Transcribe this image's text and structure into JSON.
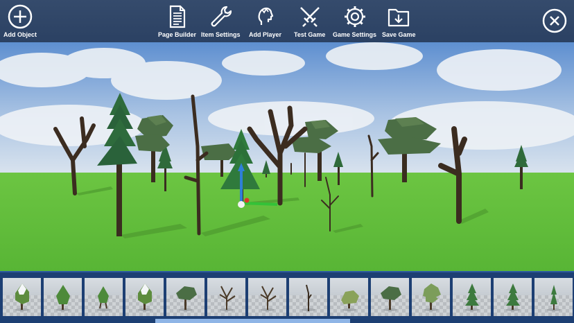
{
  "toolbar": {
    "add_object": "Add Object",
    "page_builder": "Page Builder",
    "item_settings": "Item Settings",
    "add_player": "Add Player",
    "test_game": "Test Game",
    "game_settings": "Game Settings",
    "save_game": "Save Game"
  },
  "icons": {
    "add_object": "plus-circle-icon",
    "page_builder": "document-icon",
    "item_settings": "wrench-icon",
    "add_player": "player-head-icon",
    "test_game": "crossed-swords-icon",
    "game_settings": "gear-icon",
    "save_game": "folder-download-icon",
    "close": "close-circle-icon"
  },
  "asset_tray": {
    "items": [
      {
        "kind": "snowy-bush",
        "icon": "snowy-bush-tree-icon"
      },
      {
        "kind": "cone-bush",
        "icon": "cone-bush-tree-icon"
      },
      {
        "kind": "cone-bush-small",
        "icon": "small-cone-bush-icon"
      },
      {
        "kind": "snowy-bush",
        "icon": "snowy-bush-tree-icon"
      },
      {
        "kind": "broadleaf",
        "icon": "broadleaf-tree-icon"
      },
      {
        "kind": "dead",
        "icon": "dead-tree-icon"
      },
      {
        "kind": "dead",
        "icon": "dead-tree-icon"
      },
      {
        "kind": "dead-thin",
        "icon": "thin-dead-tree-icon"
      },
      {
        "kind": "bush",
        "icon": "low-bush-icon"
      },
      {
        "kind": "broadleaf",
        "icon": "broadleaf-tree-icon"
      },
      {
        "kind": "broadleaf-tall",
        "icon": "tall-broadleaf-tree-icon"
      },
      {
        "kind": "pine",
        "icon": "pine-tree-icon"
      },
      {
        "kind": "pine",
        "icon": "pine-tree-icon"
      },
      {
        "kind": "pine-thin",
        "icon": "thin-pine-tree-icon"
      }
    ]
  },
  "scrollbar": {
    "position": 0.27,
    "visible_fraction": 0.34
  },
  "colors": {
    "toolbar_bg": "#2f4568",
    "tray_bg": "#1d3f73",
    "grass": "#5cb83c",
    "foliage_pine": "#2e6b3c",
    "foliage_broad": "#4a6c44",
    "gizmo_up": "#2f7fd8",
    "gizmo_right": "#34c238"
  }
}
